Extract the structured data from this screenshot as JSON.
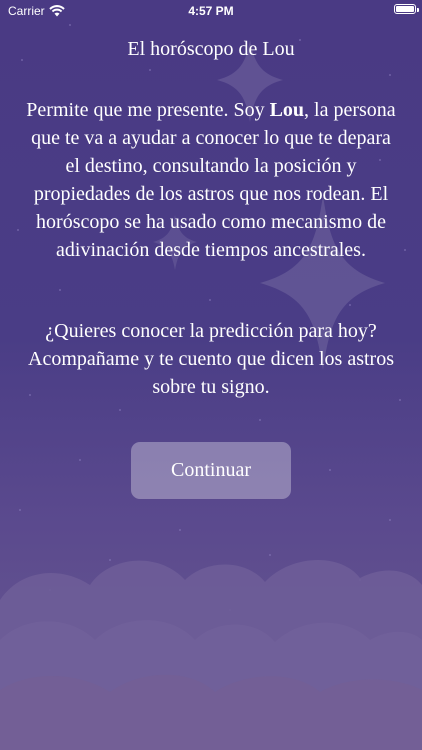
{
  "status_bar": {
    "carrier": "Carrier",
    "time": "4:57 PM"
  },
  "content": {
    "title": "El horóscopo de Lou",
    "intro_before": "Permite que me presente. Soy ",
    "intro_name": "Lou",
    "intro_after": ", la persona que te va a ayudar a conocer lo que te depara el destino, consultando la posición y propiedades de los astros que nos rodean. El horóscopo se ha usado como mecanismo de adivinación desde tiempos ancestrales.",
    "question": "¿Quieres conocer la predicción para hoy? Acompañame y te cuento que dicen los astros sobre tu signo."
  },
  "actions": {
    "continue_label": "Continuar"
  },
  "colors": {
    "background_top": "#4a3a84",
    "background_bottom": "#6a5a91",
    "button_fill": "rgba(255,255,255,0.32)"
  }
}
